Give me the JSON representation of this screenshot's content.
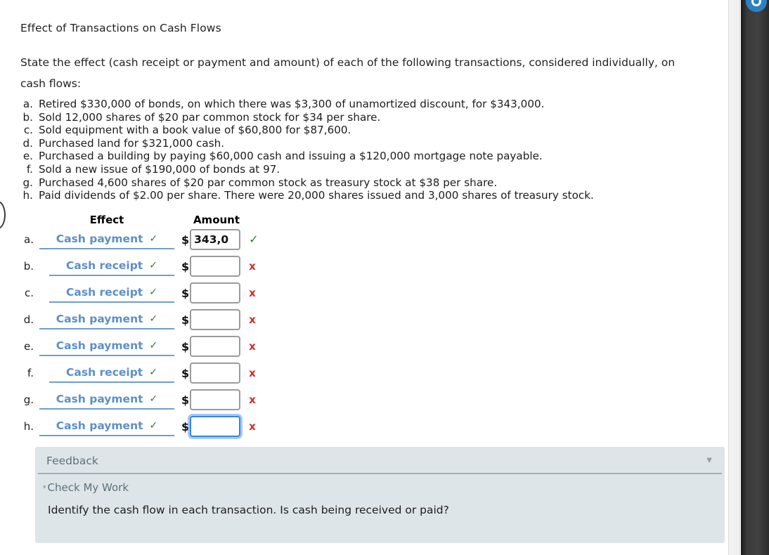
{
  "title": "Effect of Transactions on Cash Flows",
  "intro": "State the effect (cash receipt or payment and amount) of each of the following transactions, considered individually, on cash flows:",
  "transactions": [
    {
      "letter": "a.",
      "text": "Retired $330,000 of bonds, on which there was $3,300 of unamortized discount, for $343,000."
    },
    {
      "letter": "b.",
      "text": "Sold 12,000 shares of $20 par common stock for $34 per share."
    },
    {
      "letter": "c.",
      "text": "Sold equipment with a book value of $60,800 for $87,600."
    },
    {
      "letter": "d.",
      "text": "Purchased land for $321,000 cash."
    },
    {
      "letter": "e.",
      "text": "Purchased a building by paying $60,000 cash and issuing a $120,000 mortgage note payable."
    },
    {
      "letter": "f.",
      "text": "Sold a new issue of $190,000 of bonds at 97."
    },
    {
      "letter": "g.",
      "text": "Purchased 4,600 shares of $20 par common stock as treasury stock at $38 per share."
    },
    {
      "letter": "h.",
      "text": "Paid dividends of $2.00 per share. There were 20,000 shares issued and 3,000 shares of treasury stock."
    }
  ],
  "table": {
    "header_effect": "Effect",
    "header_amount": "Amount",
    "currency_symbol": "$",
    "rows": [
      {
        "letter": "a.",
        "effect": "Cash payment",
        "effect_mark": "✓",
        "amount": "343,0",
        "amount_mark": "✓",
        "amount_status": "correct",
        "focused": false,
        "narrow": false
      },
      {
        "letter": "b.",
        "effect": "Cash receipt",
        "effect_mark": "✓",
        "amount": "",
        "amount_mark": "x",
        "amount_status": "incorrect",
        "focused": false,
        "narrow": true
      },
      {
        "letter": "c.",
        "effect": "Cash receipt",
        "effect_mark": "✓",
        "amount": "",
        "amount_mark": "x",
        "amount_status": "incorrect",
        "focused": false,
        "narrow": true
      },
      {
        "letter": "d.",
        "effect": "Cash payment",
        "effect_mark": "✓",
        "amount": "",
        "amount_mark": "x",
        "amount_status": "incorrect",
        "focused": false,
        "narrow": false
      },
      {
        "letter": "e.",
        "effect": "Cash payment",
        "effect_mark": "✓",
        "amount": "",
        "amount_mark": "x",
        "amount_status": "incorrect",
        "focused": false,
        "narrow": false
      },
      {
        "letter": "f.",
        "effect": "Cash receipt",
        "effect_mark": "✓",
        "amount": "",
        "amount_mark": "x",
        "amount_status": "incorrect",
        "focused": false,
        "narrow": true
      },
      {
        "letter": "g.",
        "effect": "Cash payment",
        "effect_mark": "✓",
        "amount": "",
        "amount_mark": "x",
        "amount_status": "incorrect",
        "focused": false,
        "narrow": false
      },
      {
        "letter": "h.",
        "effect": "Cash payment",
        "effect_mark": "✓",
        "amount": "",
        "amount_mark": "x",
        "amount_status": "incorrect",
        "focused": true,
        "narrow": false
      }
    ]
  },
  "feedback": {
    "title": "Feedback",
    "collapse_caret": "▼",
    "check_my_work_caret": "▾",
    "check_my_work": "Check My Work",
    "body": "Identify the cash flow in each transaction. Is cash being received or paid?"
  },
  "colors": {
    "link_blue": "#5b8fc9",
    "correct_green": "#2e7d32",
    "incorrect_red": "#d92b20",
    "focus_blue": "#3c82e0",
    "feedback_bg": "#dee5e8",
    "badge_blue": "#2b81c4"
  }
}
